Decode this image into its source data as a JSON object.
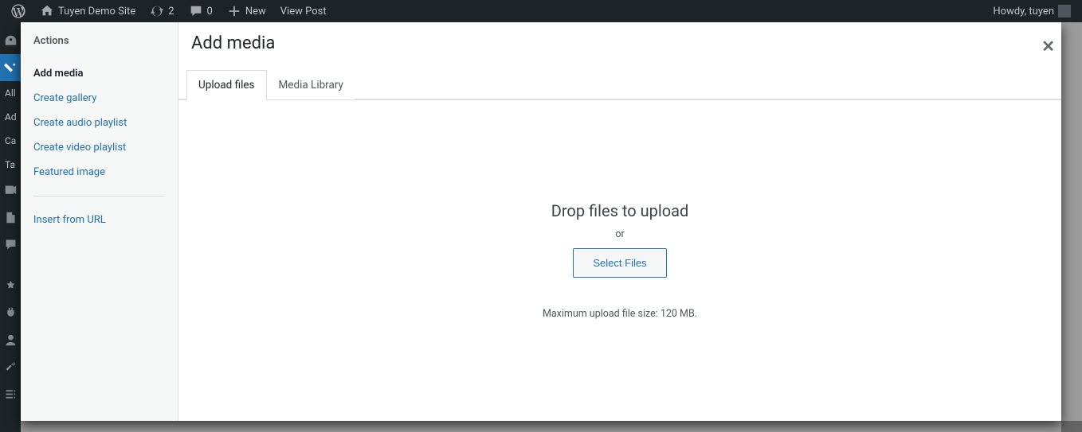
{
  "adminbar": {
    "site_name": "Tuyen Demo Site",
    "updates_count": "2",
    "comments_count": "0",
    "new_label": "New",
    "view_post": "View Post",
    "howdy": "Howdy, tuyen"
  },
  "behind_menu": {
    "all": "All",
    "ad": "Ad",
    "ca": "Ca",
    "ta": "Ta"
  },
  "media": {
    "sidebar_heading": "Actions",
    "links": {
      "add_media": "Add media",
      "create_gallery": "Create gallery",
      "create_audio": "Create audio playlist",
      "create_video": "Create video playlist",
      "featured_image": "Featured image",
      "insert_url": "Insert from URL"
    },
    "title": "Add media",
    "tabs": {
      "upload": "Upload files",
      "library": "Media Library"
    },
    "upload": {
      "drop": "Drop files to upload",
      "or": "or",
      "select_files": "Select Files",
      "hint": "Maximum upload file size: 120 MB."
    },
    "close": "✕"
  }
}
